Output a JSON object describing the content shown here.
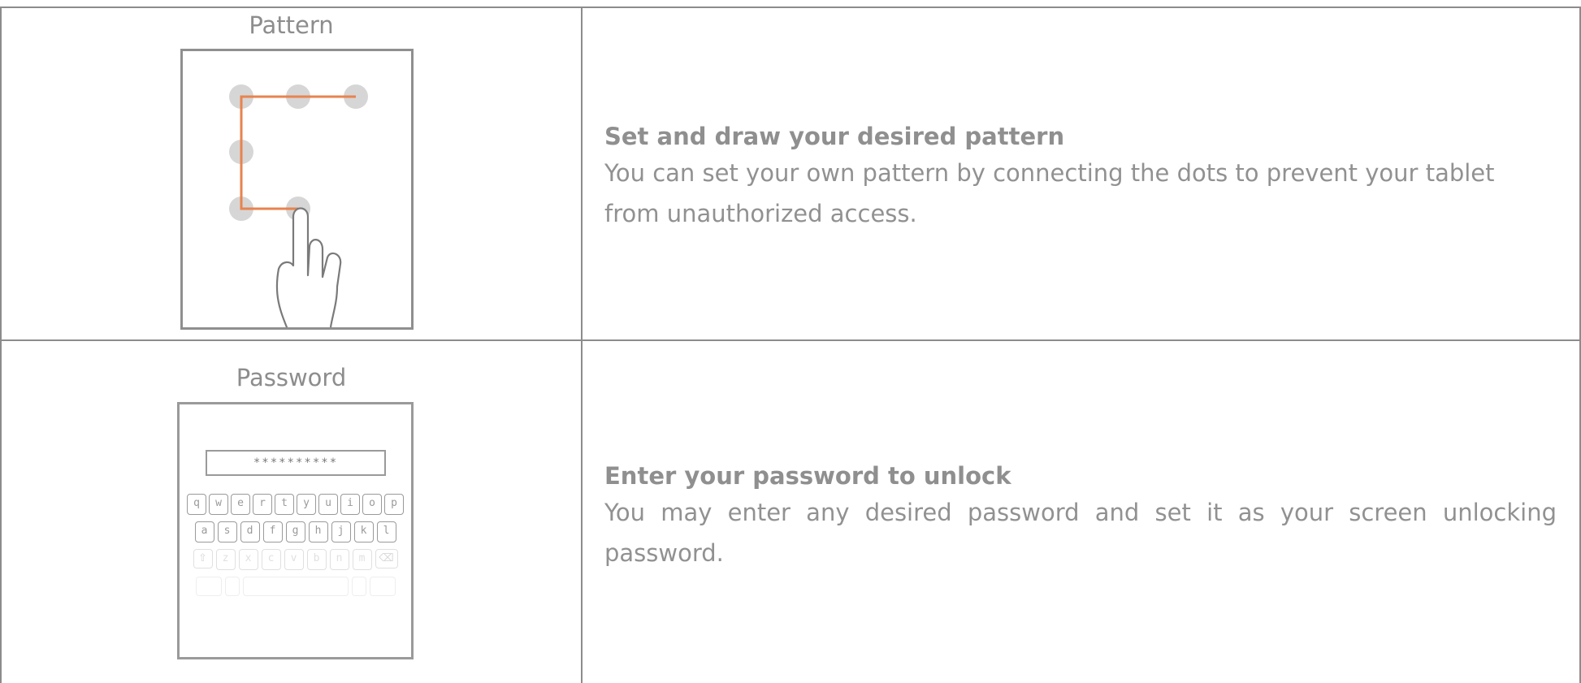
{
  "rows": [
    {
      "label": "Pattern",
      "title": "Set and draw your desired pattern",
      "body": "You can set your own pattern by connecting the dots to prevent your tablet from unauthorized access."
    },
    {
      "label": "Password",
      "title": "Enter your password to unlock",
      "body": "You may enter any desired password and set it as your screen unlocking password.",
      "password_mask": "**********",
      "keyboard": {
        "row1": [
          "q",
          "w",
          "e",
          "r",
          "t",
          "y",
          "u",
          "i",
          "o",
          "p"
        ],
        "row2": [
          "a",
          "s",
          "d",
          "f",
          "g",
          "h",
          "j",
          "k",
          "l"
        ],
        "row3": [
          "z",
          "x",
          "c",
          "v",
          "b",
          "n",
          "m"
        ]
      }
    }
  ],
  "colors": {
    "border": "#8c8c8c",
    "pattern_line": "#e8834f",
    "dot": "#d6d6d6",
    "text": "#8a8a8a"
  },
  "icons": [
    "pattern-lock-illustration",
    "hand-pointer-icon",
    "keyboard-illustration",
    "shift-icon",
    "backspace-icon"
  ]
}
